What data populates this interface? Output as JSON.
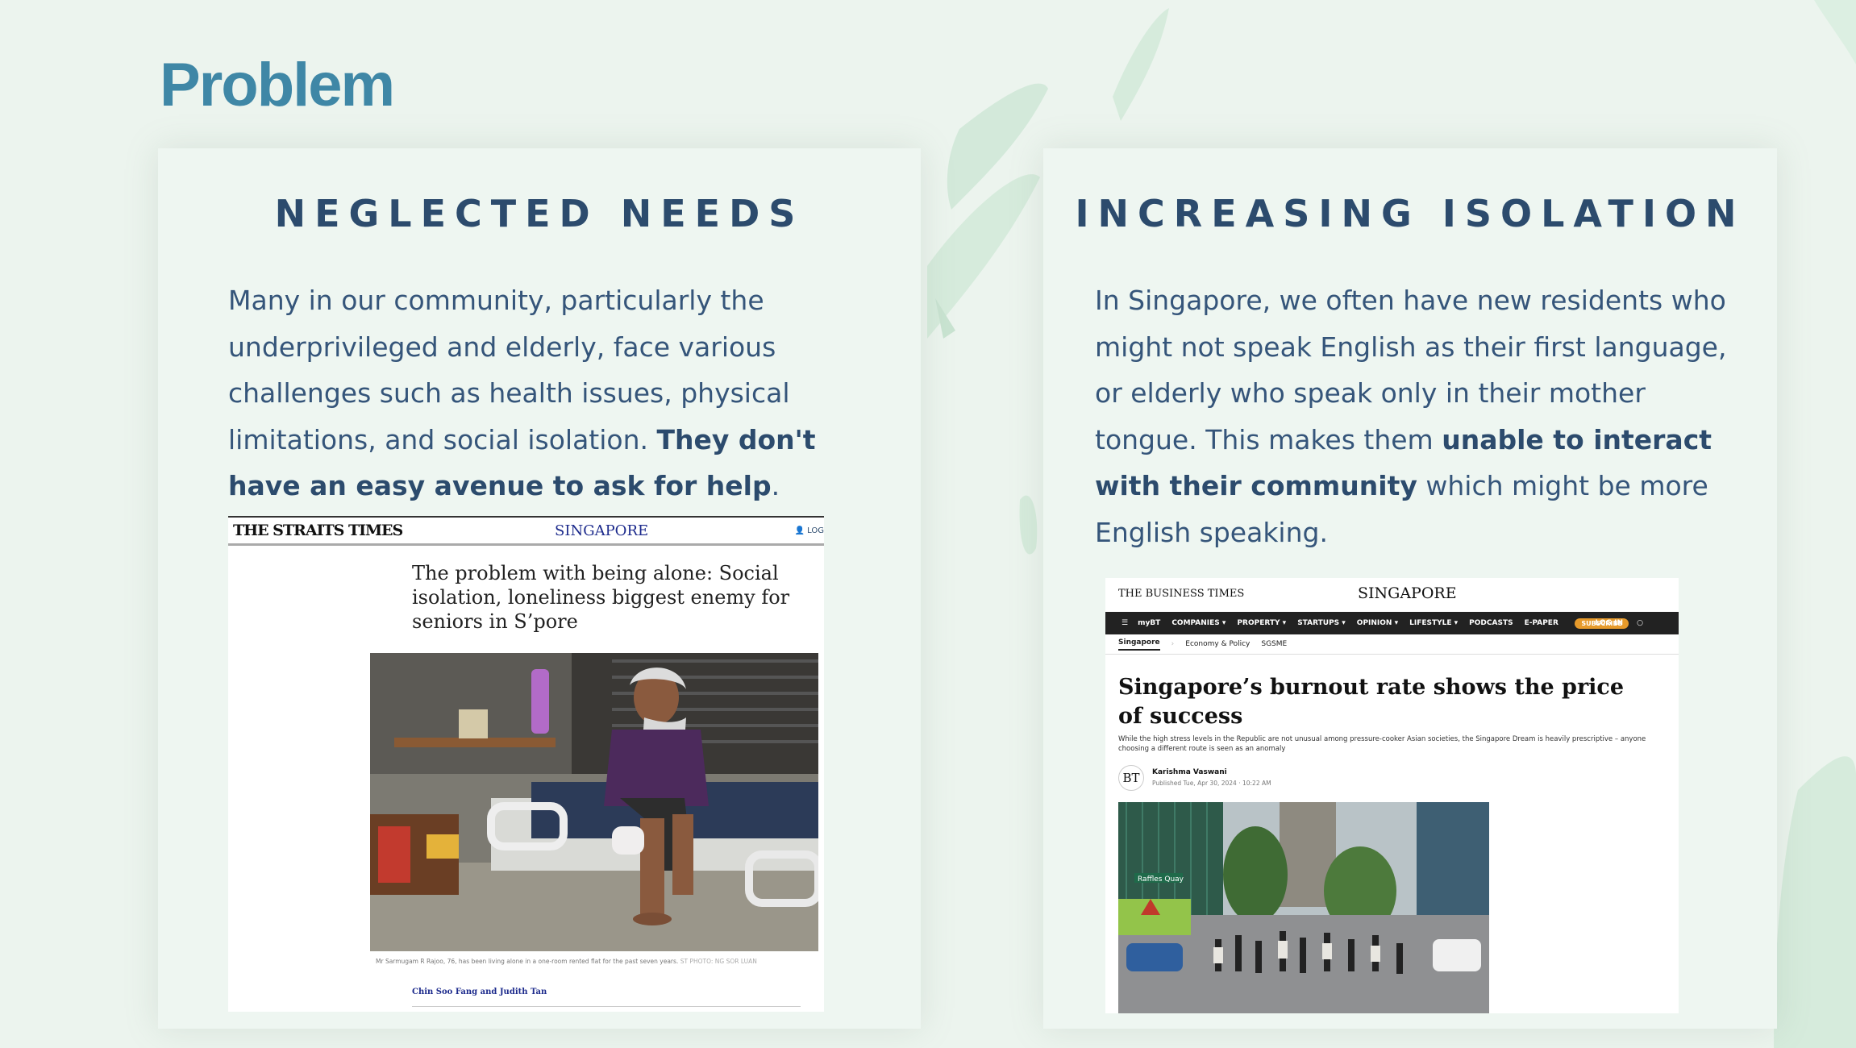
{
  "title": "Problem",
  "left_card": {
    "heading": "NEGLECTED NEEDS",
    "body_plain": "Many in our community, particularly the underprivileged and elderly, face various challenges such as health issues, physical limitations, and social isolation. ",
    "body_bold": "They don't have an easy avenue to ask for help",
    "body_end": ".",
    "clipping": {
      "logo": "THE STRAITS TIMES",
      "section": "SINGAPORE",
      "login": "LOG",
      "headline": "The problem with being alone: Social isolation, loneliness biggest enemy for seniors in S’pore",
      "caption": "Mr Sarmugam R Rajoo, 76, has been living alone in a one-room rented flat for the past seven years.",
      "photo_credit": "ST PHOTO: NG SOR LUAN",
      "byline": "Chin Soo Fang and Judith Tan"
    }
  },
  "right_card": {
    "heading": "INCREASING ISOLATION",
    "body_plain": "In Singapore, we often have new residents who might not speak English as their first language, or elderly who speak only in their mother tongue. This makes them ",
    "body_bold": "unable to interact with their community",
    "body_end": " which might be more English speaking.",
    "clipping": {
      "logo": "THE BUSINESS TIMES",
      "section": "SINGAPORE",
      "nav": [
        "myBT",
        "COMPANIES ▾",
        "PROPERTY ▾",
        "STARTUPS ▾",
        "OPINION ▾",
        "LIFESTYLE ▾",
        "PODCASTS",
        "E-PAPER"
      ],
      "subscribe": "SUBSCRIBE",
      "login": "LOG IN",
      "subnav_active": "Singapore",
      "subnav": [
        "Economy & Policy",
        "SGSME"
      ],
      "headline": "Singapore’s burnout rate shows the price of success",
      "dek": "While the high stress levels in the Republic are not unusual among pressure-cooker Asian societies, the Singapore Dream is heavily prescriptive – anyone choosing a different route is seen as an anomaly",
      "badge": "BT",
      "author": "Karishma Vaswani",
      "published": "Published Tue, Apr 30, 2024 · 10:22 AM",
      "street_sign": "Raffles Quay"
    }
  },
  "colors": {
    "background": "#ecf4ee",
    "title": "#3f87a6",
    "text": "#2c4b6d",
    "brush": "#cfe6d6"
  }
}
